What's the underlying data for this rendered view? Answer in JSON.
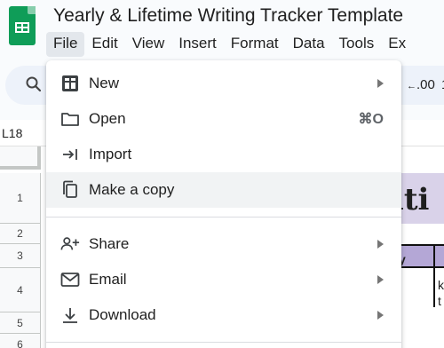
{
  "app": {
    "title": "Yearly & Lifetime Writing Tracker Template"
  },
  "menubar": {
    "items": [
      "File",
      "Edit",
      "View",
      "Insert",
      "Format",
      "Data",
      "Tools",
      "Ex"
    ]
  },
  "toolbar": {
    "decimal_label": ".00",
    "font_size_fragment": "1"
  },
  "formula_bar": {
    "cell_reference": "L18"
  },
  "grid": {
    "row_headers": [
      "1",
      "2",
      "3",
      "4",
      "5",
      "6"
    ],
    "title_fragment": "riti",
    "header_fragment": "y",
    "cell_fragment": "k\nt"
  },
  "file_menu": {
    "items": [
      {
        "label": "New",
        "icon": "new-spreadsheet-icon",
        "submenu": true
      },
      {
        "label": "Open",
        "icon": "folder-icon",
        "shortcut": "⌘O"
      },
      {
        "label": "Import",
        "icon": "import-icon"
      },
      {
        "label": "Make a copy",
        "icon": "copy-icon",
        "highlighted": true
      },
      {
        "label": "Share",
        "icon": "share-person-icon",
        "submenu": true
      },
      {
        "label": "Email",
        "icon": "email-icon",
        "submenu": true
      },
      {
        "label": "Download",
        "icon": "download-icon",
        "submenu": true
      }
    ]
  },
  "colors": {
    "sheets_green": "#0f9d58",
    "menu_highlight": "#f1f3f4",
    "title_band": "#d9d2e9",
    "header_band": "#b4a7d6"
  }
}
